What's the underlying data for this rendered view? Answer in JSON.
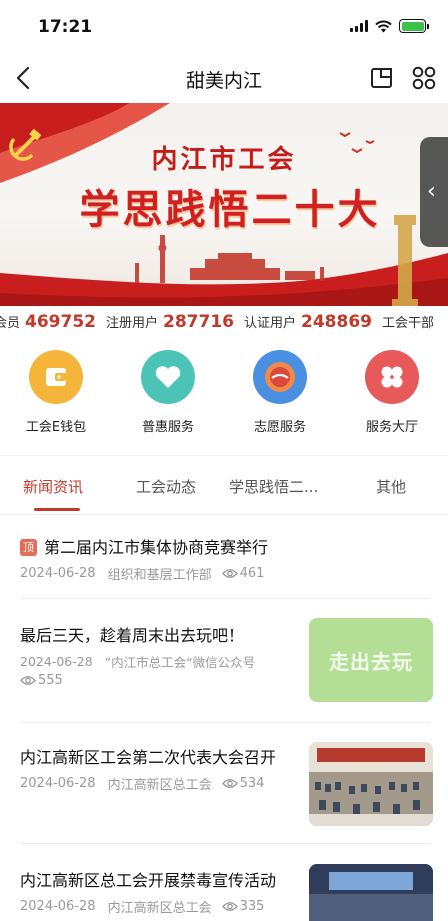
{
  "status_bar": {
    "time": "17:21"
  },
  "nav": {
    "title": "甜美内江"
  },
  "banner": {
    "line1": "内江市工会",
    "line2": "学思践悟二十大"
  },
  "stats": [
    {
      "label": "会员",
      "value": "469752"
    },
    {
      "label": "注册用户",
      "value": "287716"
    },
    {
      "label": "认证用户",
      "value": "248869"
    },
    {
      "label": "工会干部",
      "value": ""
    }
  ],
  "services": [
    {
      "label": "工会E钱包",
      "icon": "wallet-icon",
      "color": "#f5b53a"
    },
    {
      "label": "普惠服务",
      "icon": "heart-icon",
      "color": "#4cc3b7"
    },
    {
      "label": "志愿服务",
      "icon": "volunteer-icon",
      "color": "#4a90e2"
    },
    {
      "label": "服务大厅",
      "icon": "clover-icon",
      "color": "#e85a5a"
    }
  ],
  "tabs": [
    {
      "label": "新闻资讯",
      "active": true
    },
    {
      "label": "工会动态",
      "active": false
    },
    {
      "label": "学思践悟二...",
      "active": false
    },
    {
      "label": "其他",
      "active": false
    }
  ],
  "news": [
    {
      "badge": "顶",
      "title": "第二届内江市集体协商竞赛举行",
      "date": "2024-06-28",
      "source": "组织和基层工作部",
      "views": "461"
    },
    {
      "title": "最后三天，趁着周末出去玩吧！",
      "date": "2024-06-28",
      "source": "”内江市总工会“微信公众号",
      "views": "555",
      "thumb_text": "走出去玩"
    },
    {
      "title": "内江高新区工会第二次代表大会召开",
      "date": "2024-06-28",
      "source": "内江高新区总工会",
      "views": "534"
    },
    {
      "title": "内江高新区总工会开展禁毒宣传活动",
      "date": "2024-06-28",
      "source": "内江高新区总工会",
      "views": "335"
    }
  ],
  "colors": {
    "accent": "#c0392b",
    "badge": "#e46d56"
  }
}
